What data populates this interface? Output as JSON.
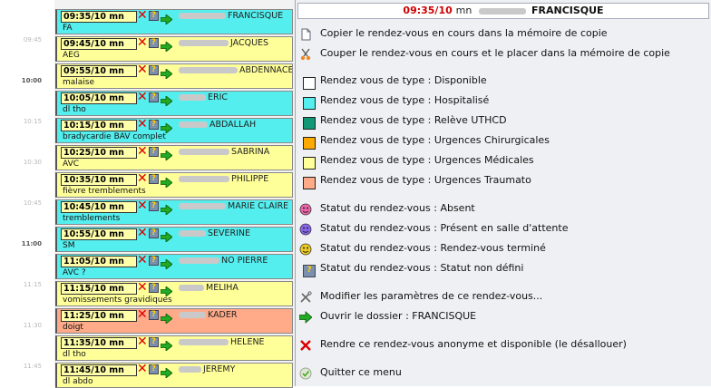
{
  "time_labels": [
    {
      "text": "09:45",
      "hour": false
    },
    {
      "text": "10:00",
      "hour": true
    },
    {
      "text": "10:15",
      "hour": false
    },
    {
      "text": "10:30",
      "hour": false
    },
    {
      "text": "10:45",
      "hour": false
    },
    {
      "text": "11:00",
      "hour": true
    },
    {
      "text": "11:15",
      "hour": false
    },
    {
      "text": "11:30",
      "hour": false
    },
    {
      "text": "11:45",
      "hour": false
    }
  ],
  "appointments": [
    {
      "time": "09:35/10 mn",
      "name": "FRANCISQUE",
      "reason": "FA",
      "color": "#55eeee"
    },
    {
      "time": "09:45/10 mn",
      "name": "JACQUES",
      "reason": "AEG",
      "color": "#ffff99"
    },
    {
      "time": "09:55/10 mn",
      "name": "ABDENNACEUR",
      "reason": "malaise",
      "color": "#ffff99"
    },
    {
      "time": "10:05/10 mn",
      "name": "ERIC",
      "reason": "dl tho",
      "color": "#55eeee"
    },
    {
      "time": "10:15/10 mn",
      "name": "ABDALLAH",
      "reason": "bradycardie BAV complet",
      "color": "#55eeee"
    },
    {
      "time": "10:25/10 mn",
      "name": "SABRINA",
      "reason": "AVC",
      "color": "#ffff99"
    },
    {
      "time": "10:35/10 mn",
      "name": "PHILIPPE",
      "reason": "fièvre tremblements",
      "color": "#ffff99"
    },
    {
      "time": "10:45/10 mn",
      "name": "MARIE CLAIRE",
      "reason": "tremblements",
      "color": "#55eeee"
    },
    {
      "time": "10:55/10 mn",
      "name": "SEVERINE",
      "reason": "SM",
      "color": "#55eeee"
    },
    {
      "time": "11:05/10 mn",
      "name": "NO PIERRE",
      "reason": "AVC ?",
      "color": "#55eeee"
    },
    {
      "time": "11:15/10 mn",
      "name": "MELIHA",
      "reason": "vomissements gravidiques",
      "color": "#ffff99"
    },
    {
      "time": "11:25/10 mn",
      "name": "KADER",
      "reason": "doigt",
      "color": "#ffaa88"
    },
    {
      "time": "11:35/10 mn",
      "name": "HELENE",
      "reason": "dl tho",
      "color": "#ffff99"
    },
    {
      "time": "11:45/10 mn",
      "name": "JEREMY",
      "reason": "dl abdo",
      "color": "#ffff99"
    }
  ],
  "menu": {
    "header": {
      "time": "09:35/10",
      "unit": "mn",
      "name": "FRANCISQUE"
    },
    "items": [
      {
        "label": "Copier le rendez-vous en cours dans la mémoire de copie",
        "icon": "copy-icon"
      },
      {
        "label": "Couper le rendez-vous en cours et le placer dans la mémoire de copie",
        "icon": "cut-icon"
      },
      {
        "label": "Rendez vous de type : Disponible",
        "icon": "swatch-icon",
        "color": "#ffffff"
      },
      {
        "label": "Rendez vous de type : Hospitalisé",
        "icon": "swatch-icon",
        "color": "#55eeee"
      },
      {
        "label": "Rendez vous de type : Relève UTHCD",
        "icon": "swatch-icon",
        "color": "#119977"
      },
      {
        "label": "Rendez vous de type : Urgences Chirurgicales",
        "icon": "swatch-icon",
        "color": "#ffaa00"
      },
      {
        "label": "Rendez vous de type : Urgences Médicales",
        "icon": "swatch-icon",
        "color": "#ffff99"
      },
      {
        "label": "Rendez vous de type : Urgences Traumato",
        "icon": "swatch-icon",
        "color": "#ffaa88"
      },
      {
        "label": "Statut du rendez-vous : Absent",
        "icon": "status-absent-icon",
        "color": "#ee66aa"
      },
      {
        "label": "Statut du rendez-vous : Présent en salle d'attente",
        "icon": "status-waiting-icon",
        "color": "#8866ee"
      },
      {
        "label": "Statut du rendez-vous : Rendez-vous terminé",
        "icon": "status-done-icon",
        "color": "#eecc22"
      },
      {
        "label": "Statut du rendez-vous : Statut non défini",
        "icon": "status-undefined-icon",
        "color": "#7b8fae"
      },
      {
        "label": "Modifier les paramètres de ce rendez-vous...",
        "icon": "tools-icon"
      },
      {
        "label": "Ouvrir le dossier :  FRANCISQUE",
        "icon": "open-arrow-icon"
      },
      {
        "label": "Rendre ce rendez-vous anonyme et disponible (le désallouer)",
        "icon": "unassign-x-icon"
      },
      {
        "label": "Quitter ce menu",
        "icon": "quit-check-icon"
      }
    ]
  }
}
